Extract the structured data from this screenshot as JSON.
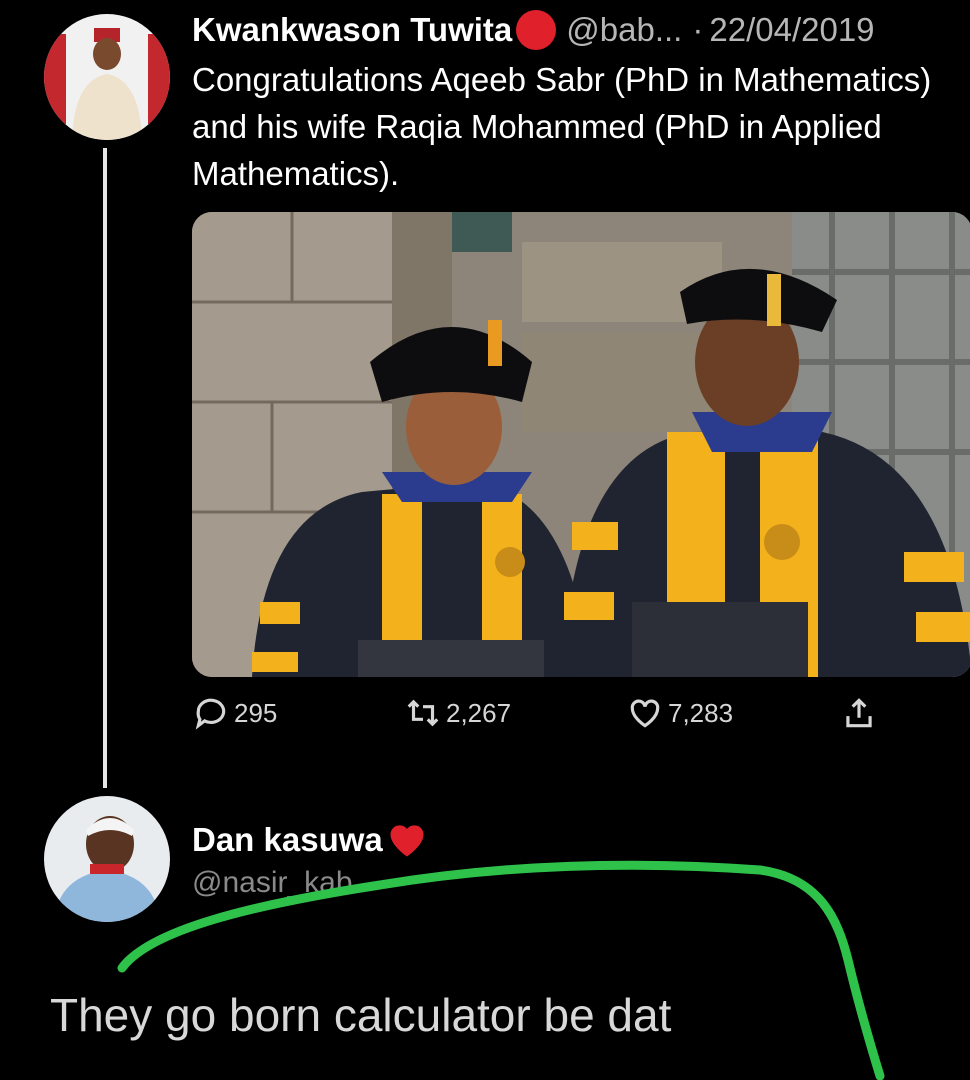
{
  "tweet": {
    "author_name": "Kwankwason Tuwita",
    "author_handle": "@bab...",
    "separator": "·",
    "date": "22/04/2019",
    "text": "Congratulations Aqeeb Sabr (PhD in Mathematics) and his wife Raqia Mohammed (PhD in Applied Mathematics).",
    "author_badge_color": "#e0212b",
    "actions": {
      "replies": "295",
      "retweets": "2,267",
      "likes": "7,283"
    }
  },
  "reply": {
    "author_name": "Dan kasuwa",
    "author_handle": "@nasir_kab",
    "text": "They go born calculator be dat",
    "heart_color": "#e0212b"
  },
  "icons": {
    "reply": "speech-bubble-icon",
    "retweet": "retweet-icon",
    "like": "heart-icon",
    "share": "share-icon"
  },
  "annotation_color": "#2ec24a"
}
